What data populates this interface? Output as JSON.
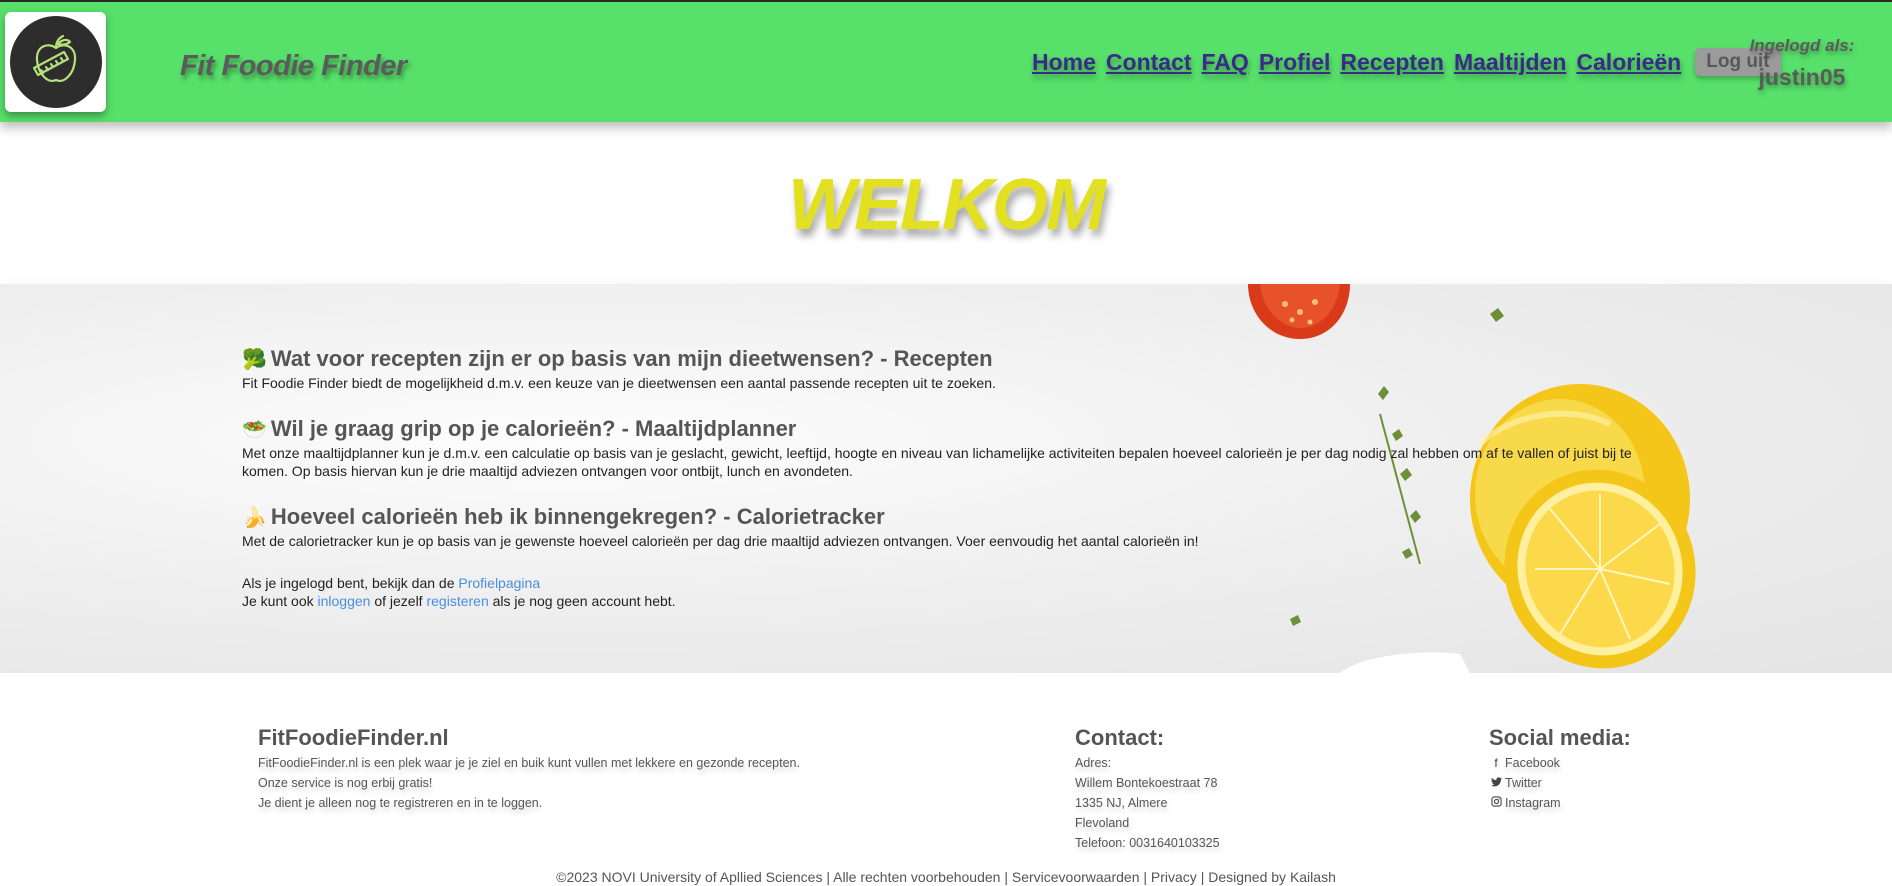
{
  "header": {
    "site_title": "Fit Foodie Finder",
    "logo_icon": "apple-measuring-tape-icon",
    "nav": [
      {
        "label": "Home",
        "name": "nav-home"
      },
      {
        "label": "Contact",
        "name": "nav-contact"
      },
      {
        "label": "FAQ",
        "name": "nav-faq"
      },
      {
        "label": "Profiel",
        "name": "nav-profiel"
      },
      {
        "label": "Recepten",
        "name": "nav-recepten"
      },
      {
        "label": "Maaltijden",
        "name": "nav-maaltijden"
      },
      {
        "label": "Calorieën",
        "name": "nav-calorieen"
      }
    ],
    "logout_label": "Log uit",
    "logged_in_label": "Ingelogd als:",
    "username": "justin05"
  },
  "welcome": {
    "title": "WELKOM"
  },
  "main": {
    "sections": [
      {
        "emoji": "🥦",
        "title": "Wat voor recepten zijn er op basis van mijn dieetwensen? - Recepten",
        "text": "Fit Foodie Finder biedt de mogelijkheid d.m.v. een keuze van je dieetwensen een aantal passende recepten uit te zoeken."
      },
      {
        "emoji": "🥗",
        "title": "Wil je graag grip op je calorieën? - Maaltijdplanner",
        "text": "Met onze maaltijdplanner kun je d.m.v. een calculatie op basis van je geslacht, gewicht, leeftijd, hoogte en niveau van lichamelijke activiteiten bepalen hoeveel calorieën je per dag nodig zal hebben om af te vallen of juist bij te komen. Op basis hiervan kun je drie maaltijd adviezen ontvangen voor ontbijt, lunch en avondeten."
      },
      {
        "emoji": "🍌",
        "title": "Hoeveel calorieën heb ik binnengekregen? - Calorietracker",
        "text": "Met de calorietracker kun je op basis van je gewenste hoeveel calorieën per dag drie maaltijd adviezen ontvangen. Voer eenvoudig het aantal calorieën in!"
      }
    ],
    "profile_line_prefix": "Als je ingelogd bent, bekijk dan de ",
    "profile_link": "Profielpagina",
    "login_line_prefix": "Je kunt ook ",
    "login_link": "inloggen",
    "login_line_middle": " of jezelf ",
    "register_link": "registeren",
    "login_line_suffix": " als je nog geen account hebt."
  },
  "footer": {
    "about": {
      "title": "FitFoodieFinder.nl",
      "lines": [
        "FitFoodieFinder.nl is een plek waar je je ziel en buik kunt vullen met lekkere en gezonde recepten.",
        "Onze service is nog erbij gratis!",
        "Je dient je alleen nog te registreren en in te loggen."
      ]
    },
    "contact": {
      "title": "Contact:",
      "lines": [
        "Adres:",
        "Willem Bontekoestraat 78",
        "1335 NJ, Almere",
        "Flevoland",
        "Telefoon: 0031640103325"
      ]
    },
    "social": {
      "title": "Social media:",
      "items": [
        {
          "label": "Facebook",
          "icon": "facebook-icon",
          "glyph": "f"
        },
        {
          "label": "Twitter",
          "icon": "twitter-icon",
          "glyph": "🐦"
        },
        {
          "label": "Instagram",
          "icon": "instagram-icon",
          "glyph": "◎"
        }
      ]
    },
    "copyright": "©2023 NOVI University of Apllied Sciences | Alle rechten voorbehouden | Servicevoorwaarden | Privacy | Designed by Kailash"
  },
  "colors": {
    "header_bg": "#57e06a",
    "nav_link": "#3a2a8a",
    "welcome_title": "#e2e020",
    "link": "#4a8ee0"
  }
}
